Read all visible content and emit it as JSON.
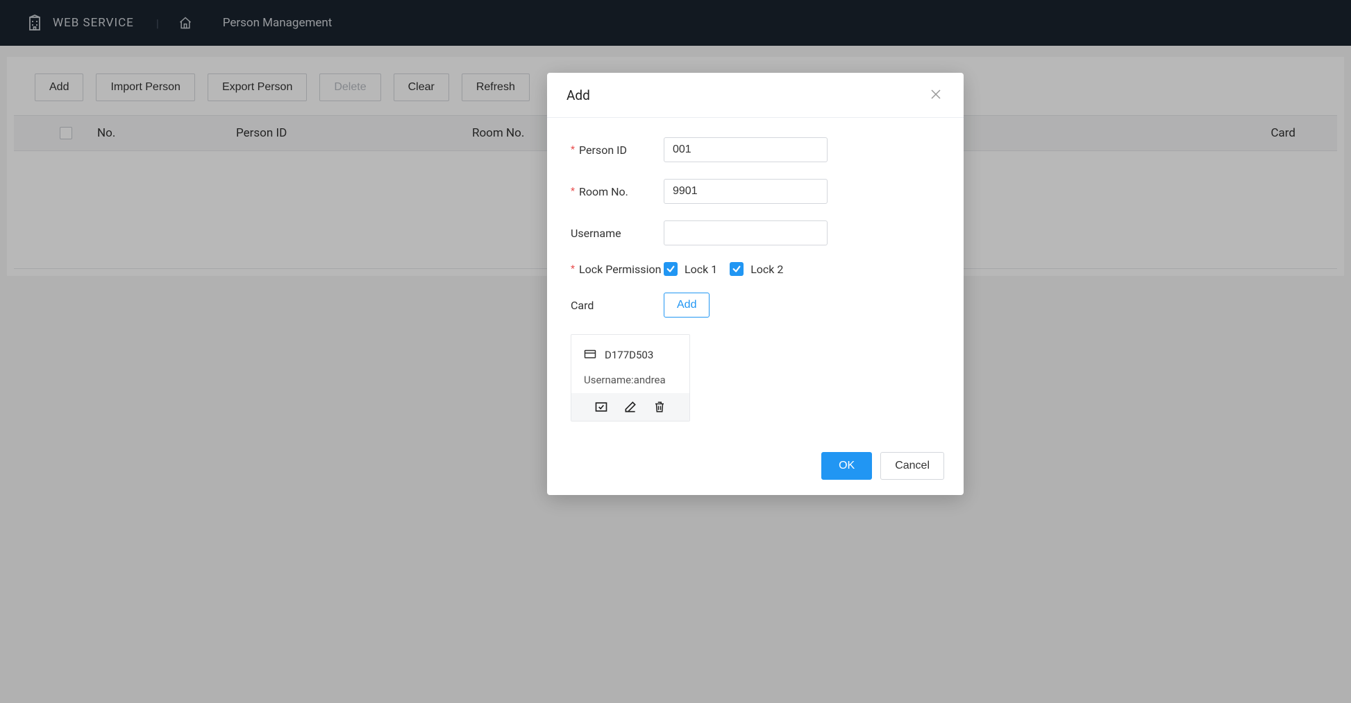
{
  "header": {
    "app_title": "WEB SERVICE",
    "page_name": "Person Management"
  },
  "toolbar": {
    "add": "Add",
    "import": "Import Person",
    "export": "Export Person",
    "delete": "Delete",
    "clear": "Clear",
    "refresh": "Refresh"
  },
  "table": {
    "columns": {
      "no": "No.",
      "person_id": "Person ID",
      "room_no": "Room No.",
      "card": "Card"
    }
  },
  "modal": {
    "title": "Add",
    "fields": {
      "person_id_label": "Person ID",
      "person_id_value": "001",
      "room_no_label": "Room No.",
      "room_no_value": "9901",
      "username_label": "Username",
      "username_value": "",
      "lock_label": "Lock Permission",
      "lock1_label": "Lock 1",
      "lock2_label": "Lock 2",
      "card_label": "Card",
      "add_card": "Add"
    },
    "card": {
      "id": "D177D503",
      "username_line": "Username:andrea"
    },
    "footer": {
      "ok": "OK",
      "cancel": "Cancel"
    }
  }
}
